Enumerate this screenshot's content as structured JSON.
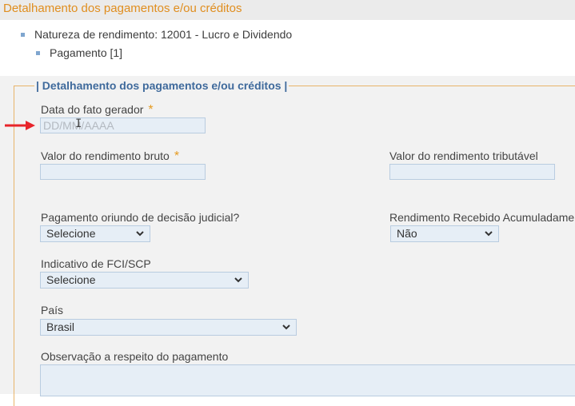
{
  "header": {
    "title": "Detalhamento dos pagamentos e/ou créditos"
  },
  "tree": {
    "items": [
      {
        "label": "Natureza de rendimento: 12001 - Lucro e Dividendo"
      },
      {
        "label": "Pagamento [1]"
      }
    ]
  },
  "form": {
    "legend": "| Detalhamento dos pagamentos e/ou créditos |",
    "required_mark": "*",
    "data_fato": {
      "label": "Data do fato gerador",
      "placeholder": "DD/MM/AAAA"
    },
    "valor_bruto": {
      "label": "Valor do rendimento bruto",
      "value": ""
    },
    "valor_tributavel": {
      "label": "Valor do rendimento tributável",
      "value": ""
    },
    "decisao_judicial": {
      "label": "Pagamento oriundo de decisão judicial?",
      "selected": "Selecione"
    },
    "rra": {
      "label": "Rendimento Recebido Acumuladamen",
      "selected": "Não"
    },
    "fci_scp": {
      "label": "Indicativo de FCI/SCP",
      "selected": "Selecione"
    },
    "pais": {
      "label": "País",
      "selected": "Brasil"
    },
    "observacao": {
      "label": "Observação a respeito do pagamento"
    }
  },
  "colors": {
    "header_title": "#e08e1f",
    "legend": "#3f6a9c",
    "required": "#e59a1f",
    "arrow": "#e8242a"
  },
  "icons": [
    "tree-bullet-icon",
    "chevron-down-icon",
    "red-arrow-icon",
    "text-cursor-icon"
  ]
}
